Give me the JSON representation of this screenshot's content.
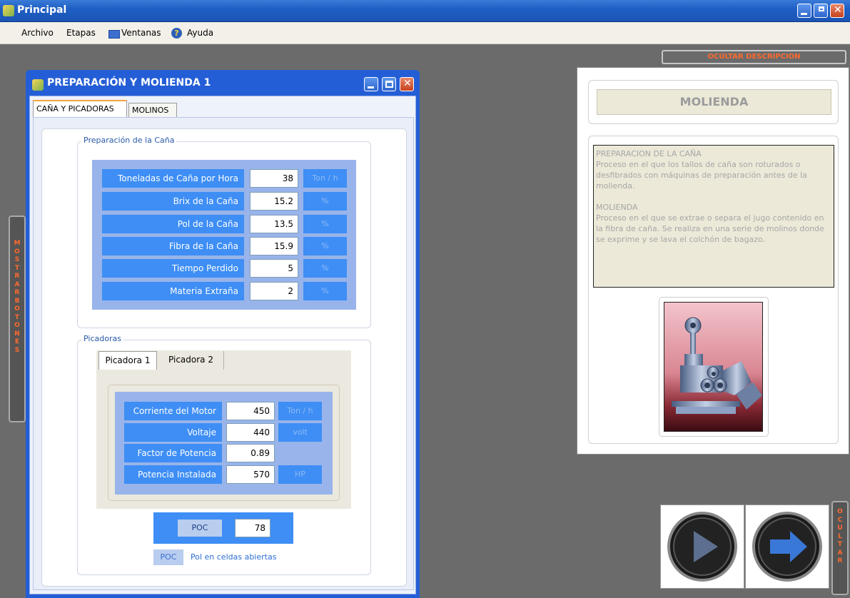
{
  "app": {
    "title": "Principal"
  },
  "menu": [
    "Archivo",
    "Etapas",
    "Ventanas",
    "Ayuda"
  ],
  "buttons": {
    "ocultar_descripcion": "OCULTAR DESCRIPCION",
    "mostrar_botones": "MOSTRAR BOTONES",
    "ocultar": "OCULTAR"
  },
  "window": {
    "title": "PREPARACIÓN Y MOLIENDA 1",
    "tabs": [
      "CAÑA Y PICADORAS",
      "MOLINOS"
    ]
  },
  "preparacion": {
    "legend": "Preparación de la Caña",
    "rows": [
      {
        "label": "Toneladas de Caña por Hora",
        "value": "38",
        "unit": "Ton / h"
      },
      {
        "label": "Brix  de la Caña",
        "value": "15.2",
        "unit": "%"
      },
      {
        "label": "Pol de la Caña",
        "value": "13.5",
        "unit": "%"
      },
      {
        "label": "Fibra de la Caña",
        "value": "15.9",
        "unit": "%"
      },
      {
        "label": "Tiempo Perdido",
        "value": "5",
        "unit": "%"
      },
      {
        "label": "Materia Extraña",
        "value": "2",
        "unit": "%"
      }
    ]
  },
  "picadoras": {
    "legend": "Picadoras",
    "tabs": [
      "Picadora 1",
      "Picadora 2"
    ],
    "rows": [
      {
        "label": "Corriente del Motor",
        "value": "450",
        "unit": "Ton / h"
      },
      {
        "label": "Voltaje",
        "value": "440",
        "unit": "volt"
      },
      {
        "label": "Factor de Potencia",
        "value": "0.89",
        "unit": ""
      },
      {
        "label": "Potencia Instalada",
        "value": "570",
        "unit": "HP"
      }
    ]
  },
  "poc": {
    "label": "POC",
    "value": "78",
    "legend_tag": "POC",
    "legend_text": "Pol en celdas abiertas"
  },
  "description": {
    "heading": "MOLIENDA",
    "title1": "PREPARACION DE LA CAÑA",
    "text1": "Proceso en el que los tallos de caña son roturados o desfibrados con máquinas de preparación antes de la molienda.",
    "title2": "MOLIENDA",
    "text2": "Proceso en el que se extrae o separa el jugo contenido en la fibra de caña. Se realiza en una serie de molinos donde se exprime y se lava el colchón de bagazo."
  },
  "colors": {
    "accent": "#3e8ef5",
    "titlebar": "#245ed6",
    "warning": "#ff6a2e"
  }
}
